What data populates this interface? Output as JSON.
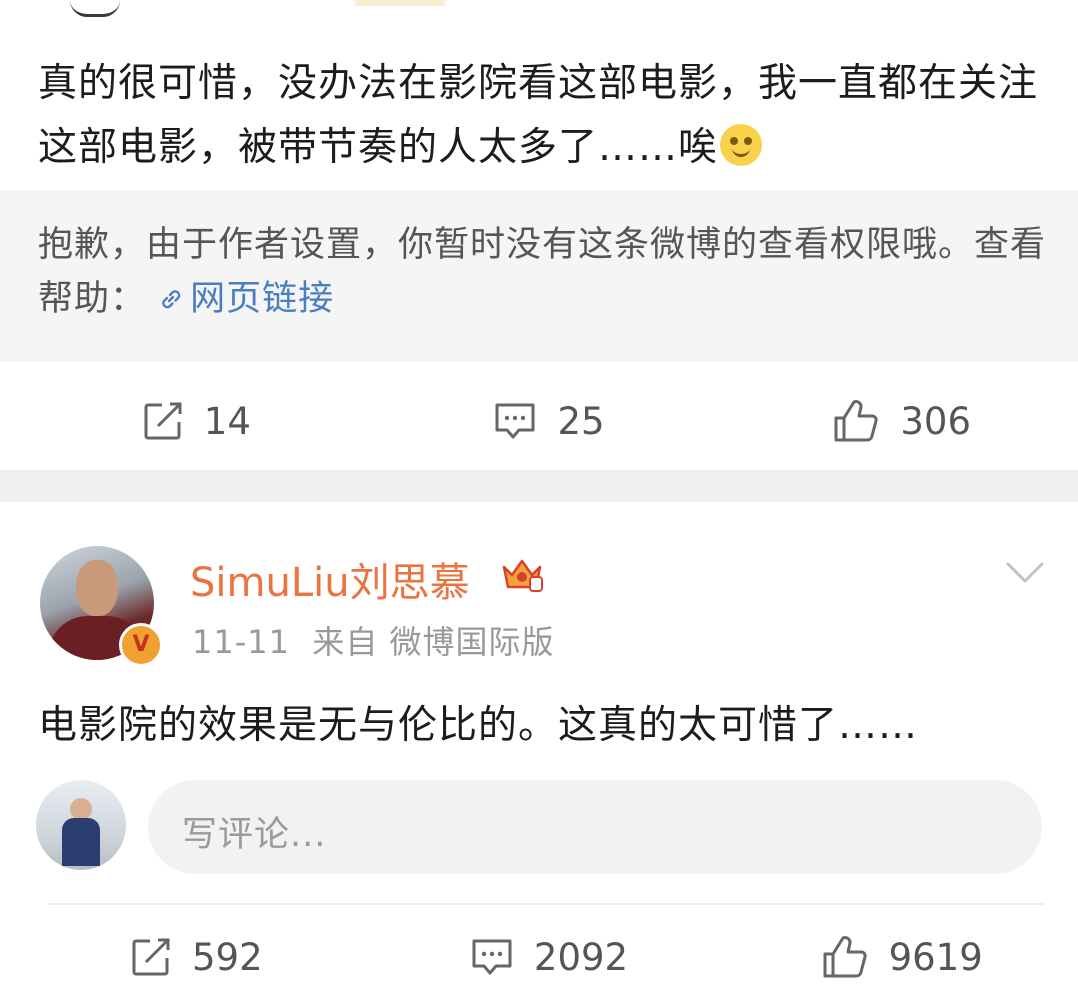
{
  "post": {
    "text": "真的很可惜，没办法在影院看这部电影，我一直都在关注这部电影，被带节奏的人太多了……唉",
    "notice_prefix": "抱歉，由于作者设置，你暂时没有这条微博的查看权限哦。查看帮助：",
    "notice_link": "网页链接",
    "actions": {
      "repost_count": "14",
      "comment_count": "25",
      "like_count": "306"
    }
  },
  "reply": {
    "username": "SimuLiu刘思慕",
    "badge_letter": "V",
    "date": "11-11",
    "source": "来自 微博国际版",
    "text": "电影院的效果是无与伦比的。这真的太可惜了……",
    "comment_placeholder": "写评论...",
    "actions": {
      "repost_count": "592",
      "comment_count": "2092",
      "like_count": "9619"
    }
  },
  "colors": {
    "username": "#eb7340",
    "link": "#4a7ec2",
    "meta": "#999999",
    "notice_bg": "#f5f5f5"
  },
  "icons": [
    "repost-icon",
    "comment-icon",
    "like-icon",
    "link-icon",
    "crown-icon",
    "chevron-down-icon",
    "verified-badge-icon",
    "emoji-icon"
  ]
}
